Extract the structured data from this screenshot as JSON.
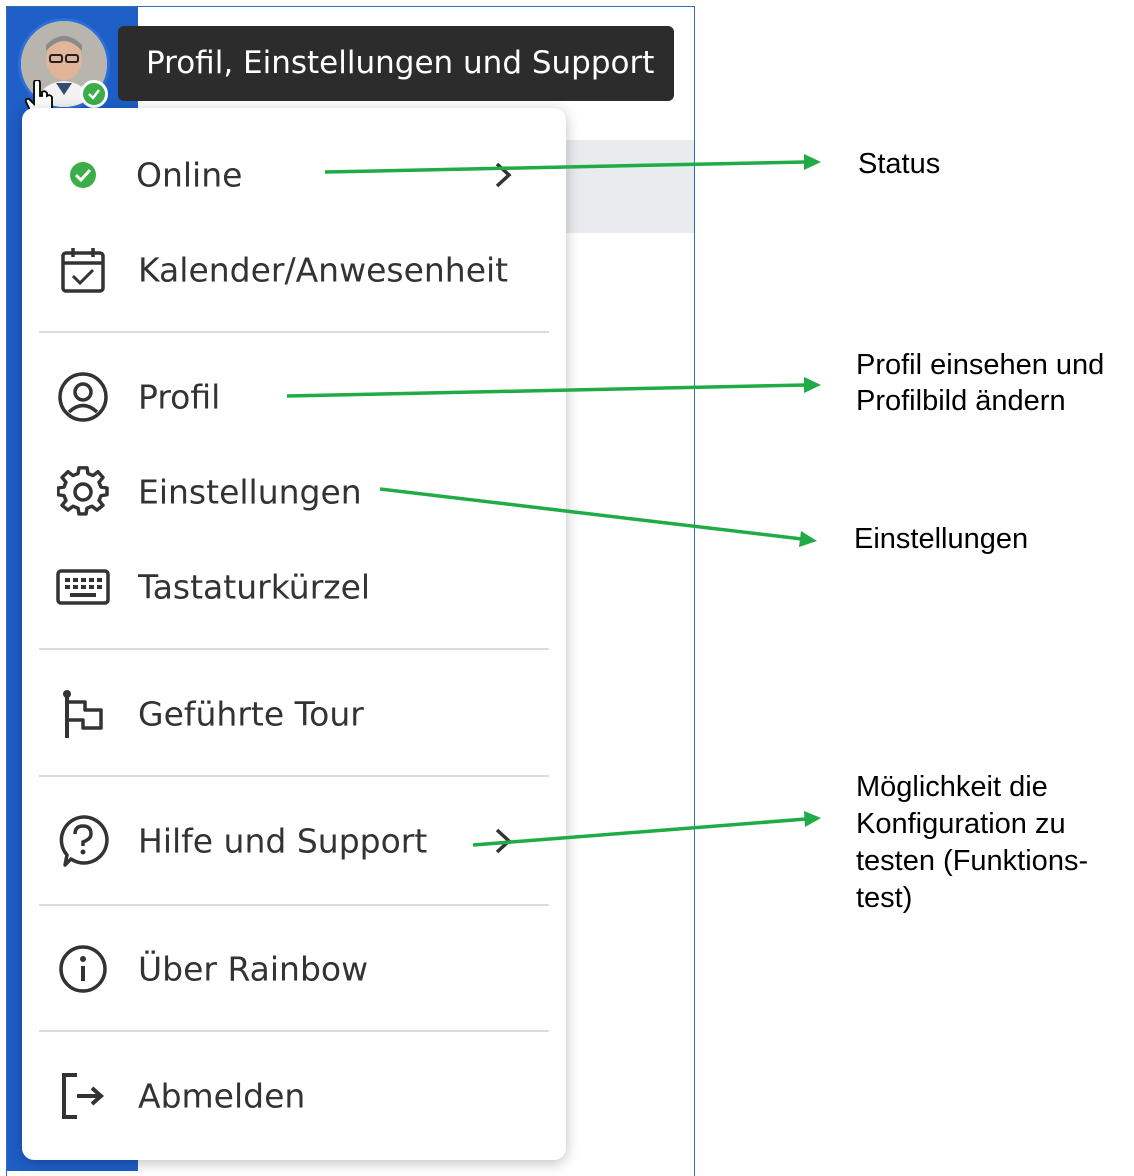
{
  "tooltip": {
    "text": "Profil, Einstellungen und Support"
  },
  "menu": {
    "items": [
      {
        "id": "online",
        "label": "Online",
        "icon": "status-online-icon",
        "has_submenu": true
      },
      {
        "id": "calendar",
        "label": "Kalender/Anwesenheit",
        "icon": "calendar-check-icon",
        "has_submenu": false
      },
      {
        "id": "profile",
        "label": "Profil",
        "icon": "user-circle-icon",
        "has_submenu": false
      },
      {
        "id": "settings",
        "label": "Einstellungen",
        "icon": "gear-icon",
        "has_submenu": false
      },
      {
        "id": "shortcuts",
        "label": "Tastaturkürzel",
        "icon": "keyboard-icon",
        "has_submenu": false
      },
      {
        "id": "tour",
        "label": "Geführte Tour",
        "icon": "flag-icon",
        "has_submenu": false
      },
      {
        "id": "help",
        "label": "Hilfe und Support",
        "icon": "help-bubble-icon",
        "has_submenu": true
      },
      {
        "id": "about",
        "label": "Über Rainbow",
        "icon": "info-icon",
        "has_submenu": false
      },
      {
        "id": "logout",
        "label": "Abmelden",
        "icon": "logout-icon",
        "has_submenu": false
      }
    ]
  },
  "annotations": {
    "status": "Status",
    "profile_line1": "Profil einsehen und",
    "profile_line2": "Profilbild ändern",
    "settings": "Einstellungen",
    "help_line1": "Möglichkeit die",
    "help_line2": "Konfiguration zu",
    "help_line3": "testen (Funktions-",
    "help_line4": "test)"
  },
  "colors": {
    "accent_green": "#1fab45",
    "status_online": "#3bad49",
    "rail_blue": "#1d5fc7",
    "tooltip_bg": "#2c2c2c"
  }
}
